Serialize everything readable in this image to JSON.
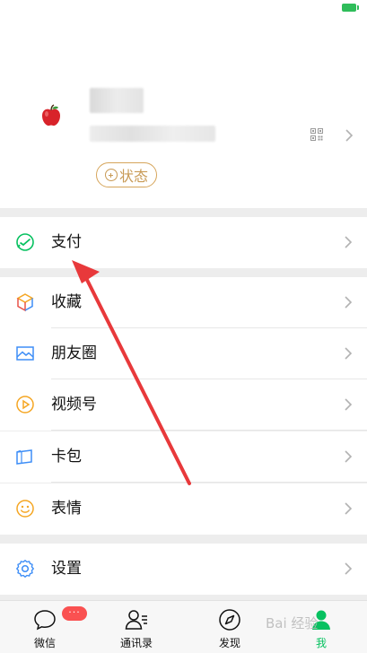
{
  "profile": {
    "status_label": "状态"
  },
  "menu": {
    "items": [
      {
        "label": "支付",
        "icon": "wallet-icon"
      },
      {
        "label": "收藏",
        "icon": "cube-icon"
      },
      {
        "label": "朋友圈",
        "icon": "image-icon"
      },
      {
        "label": "视频号",
        "icon": "play-circle-icon"
      },
      {
        "label": "卡包",
        "icon": "card-icon"
      },
      {
        "label": "表情",
        "icon": "smile-icon"
      },
      {
        "label": "设置",
        "icon": "gear-icon"
      }
    ]
  },
  "tabbar": {
    "tabs": [
      {
        "label": "微信",
        "icon": "chat-icon"
      },
      {
        "label": "通讯录",
        "icon": "contacts-icon"
      },
      {
        "label": "发现",
        "icon": "compass-icon"
      },
      {
        "label": "我",
        "icon": "person-icon",
        "active": true
      }
    ],
    "badge": "···"
  },
  "watermark": "Bai 经验",
  "colors": {
    "accent": "#07c160",
    "badge": "#fa5151",
    "status_pill": "#c89a55",
    "annotation_arrow": "#e8393b"
  }
}
